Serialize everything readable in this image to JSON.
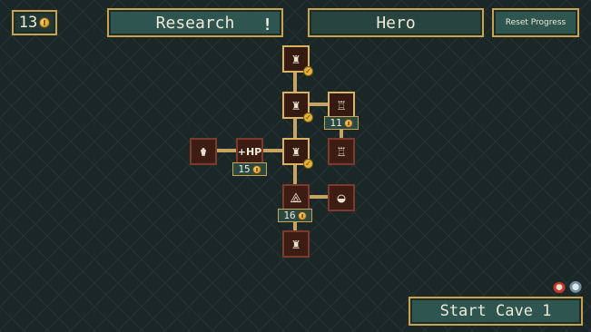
{
  "hud": {
    "coins": "13"
  },
  "tabs": {
    "research": "Research",
    "research_alert": "!",
    "hero": "Hero"
  },
  "reset_label": "Reset Progress",
  "start_label": "Start Cave 1",
  "tree": {
    "nodes": [
      {
        "id": "helm-top",
        "icon": "knight-helmet-icon",
        "glyph": "♜",
        "unlocked": true
      },
      {
        "id": "helm-mid",
        "icon": "knight-helmet-icon",
        "glyph": "♜",
        "unlocked": true
      },
      {
        "id": "armor-top",
        "icon": "chest-armor-icon",
        "glyph": "♖",
        "unlocked": false,
        "price": "11"
      },
      {
        "id": "potion",
        "icon": "potion-icon",
        "glyph": "⚱",
        "unlocked": false
      },
      {
        "id": "hp",
        "icon": "hp-boost-icon",
        "text": "+HP",
        "unlocked": false,
        "price": "15"
      },
      {
        "id": "helm-center",
        "icon": "knight-helmet-icon",
        "glyph": "♜",
        "unlocked": true
      },
      {
        "id": "armor-mid",
        "icon": "chest-armor-icon",
        "glyph": "♖",
        "unlocked": false
      },
      {
        "id": "split",
        "icon": "branch-icon",
        "glyph": "⟁",
        "unlocked": false,
        "price": "16"
      },
      {
        "id": "coin-pile",
        "icon": "coin-pile-icon",
        "glyph": "◒",
        "unlocked": false
      },
      {
        "id": "helm-bottom",
        "icon": "knight-helmet-icon",
        "glyph": "♜",
        "unlocked": false
      }
    ]
  },
  "colors": {
    "accent": "#c9a24e",
    "panel": "#2e5550",
    "background": "#1b2727",
    "node_locked": "#3d1c14"
  }
}
